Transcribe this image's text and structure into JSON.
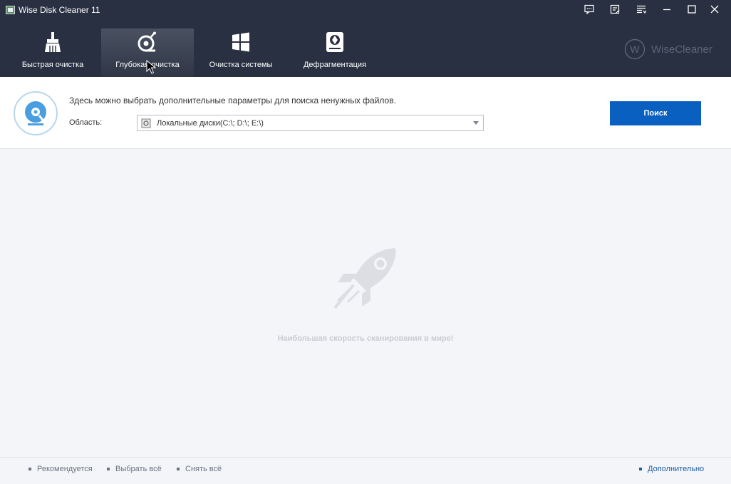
{
  "window": {
    "title": "Wise Disk Cleaner 11",
    "controls": [
      "feedback-icon",
      "checklist-icon",
      "menu-icon",
      "minimize-icon",
      "maximize-icon",
      "close-icon"
    ]
  },
  "nav": {
    "tabs": [
      {
        "label": "Быстрая очистка",
        "icon": "broom-icon",
        "active": false
      },
      {
        "label": "Глубокая очистка",
        "icon": "deep-clean-icon",
        "active": true
      },
      {
        "label": "Очистка системы",
        "icon": "windows-icon",
        "active": false
      },
      {
        "label": "Дефрагментация",
        "icon": "disk-icon",
        "active": false
      }
    ]
  },
  "brand": {
    "initial": "W",
    "text": "WiseCleaner"
  },
  "options": {
    "description": "Здесь можно выбрать дополнительные параметры для поиска ненужных файлов.",
    "scope_label": "Область:",
    "scope_value": "Локальные диски(C:\\; D:\\; E:\\)",
    "search_button": "Поиск"
  },
  "empty_state": {
    "text": "Наибольшая скорость сканирования в мире!",
    "icon": "rocket-icon"
  },
  "footer": {
    "recommended": "Рекомендуется",
    "select_all": "Выбрать всё",
    "deselect_all": "Снять всё",
    "advanced": "Дополнительно"
  },
  "colors": {
    "header_bg": "#293041",
    "accent_button": "#0a60c0",
    "content_bg": "#f4f5f8",
    "link": "#1e5ea8"
  }
}
